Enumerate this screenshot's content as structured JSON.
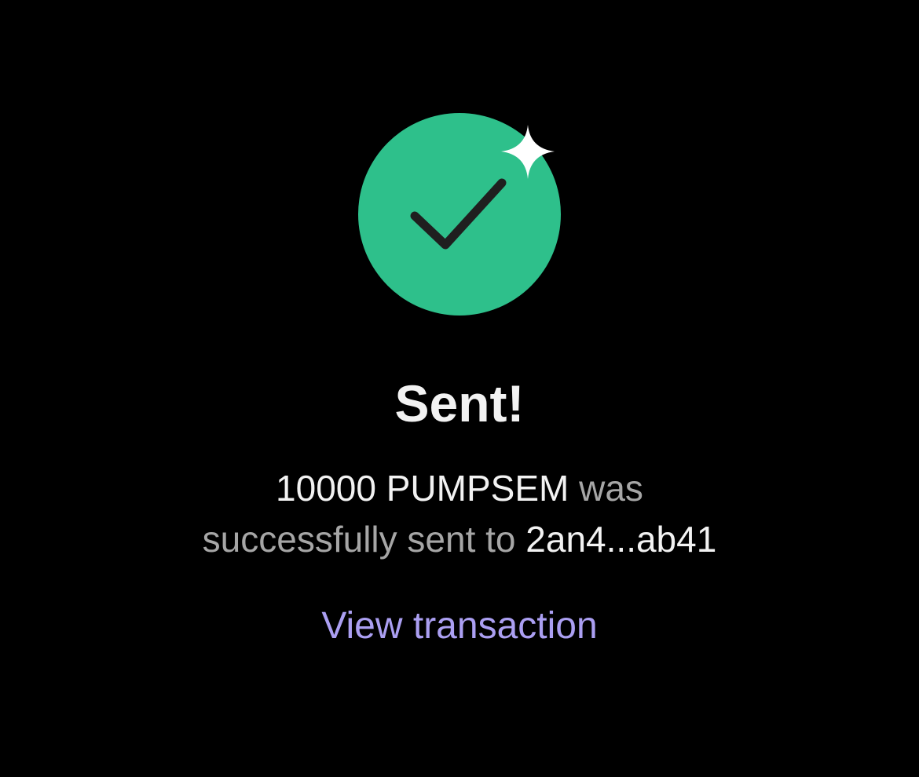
{
  "colors": {
    "background": "#000000",
    "success_green": "#2ec08b",
    "check_stroke": "#1f1f1f",
    "sparkle": "#ffffff",
    "text_primary": "#f2f2f2",
    "text_secondary": "#a6a6a6",
    "link": "#ab9ff2"
  },
  "icon": {
    "name": "success-check-icon",
    "accent": "sparkle-icon"
  },
  "status": {
    "title": "Sent!",
    "amount": "10000",
    "token": "PUMPSEM",
    "message_part1": "was",
    "message_part2": "successfully sent to",
    "recipient": "2an4...ab41"
  },
  "actions": {
    "view_transaction_label": "View transaction"
  }
}
